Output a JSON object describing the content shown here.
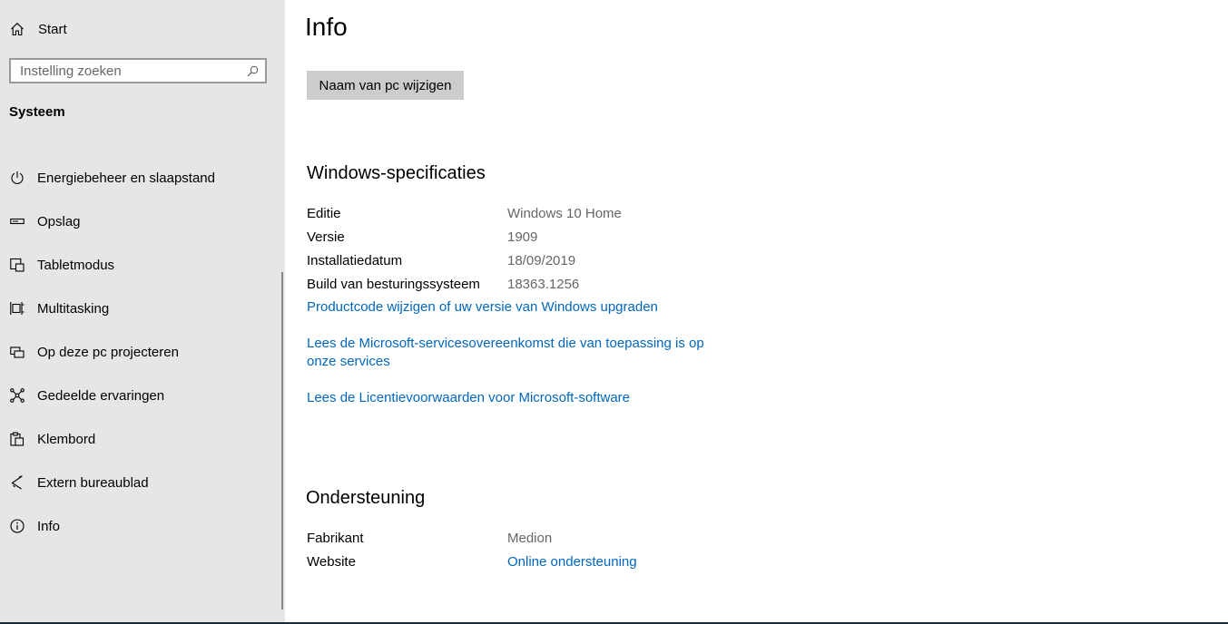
{
  "sidebar": {
    "home": {
      "label": "Start",
      "icon": "home-icon"
    },
    "search": {
      "placeholder": "Instelling zoeken",
      "value": ""
    },
    "section_title": "Systeem",
    "items": [
      {
        "label": "Energiebeheer en slaapstand",
        "icon": "power-icon"
      },
      {
        "label": "Opslag",
        "icon": "storage-icon"
      },
      {
        "label": "Tabletmodus",
        "icon": "tablet-mode-icon"
      },
      {
        "label": "Multitasking",
        "icon": "multitasking-icon"
      },
      {
        "label": "Op deze pc projecteren",
        "icon": "project-icon"
      },
      {
        "label": "Gedeelde ervaringen",
        "icon": "shared-experiences-icon"
      },
      {
        "label": "Klembord",
        "icon": "clipboard-icon"
      },
      {
        "label": "Extern bureaublad",
        "icon": "remote-desktop-icon"
      },
      {
        "label": "Info",
        "icon": "info-icon"
      }
    ]
  },
  "main": {
    "title": "Info",
    "rename_button": "Naam van pc wijzigen",
    "windows_specs": {
      "heading": "Windows-specificaties",
      "rows": [
        {
          "key": "Editie",
          "value": "Windows 10 Home"
        },
        {
          "key": "Versie",
          "value": "1909"
        },
        {
          "key": "Installatiedatum",
          "value": "18/09/2019"
        },
        {
          "key": "Build van besturingssysteem",
          "value": "18363.1256"
        }
      ],
      "links": {
        "product_key": "Productcode wijzigen of uw versie van Windows upgraden",
        "services_agreement_line1": "Lees de Microsoft-servicesovereenkomst die van toepassing is op",
        "services_agreement_line2": "onze services",
        "license_terms": "Lees de Licentievoorwaarden voor Microsoft-software"
      }
    },
    "support": {
      "heading": "Ondersteuning",
      "manufacturer_key": "Fabrikant",
      "manufacturer_value": "Medion",
      "website_key": "Website",
      "website_value": "Online ondersteuning"
    }
  },
  "colors": {
    "sidebar_bg": "#e6e6e6",
    "link": "#0067c0",
    "value_text": "#666666",
    "button_bg": "#cccccc"
  }
}
